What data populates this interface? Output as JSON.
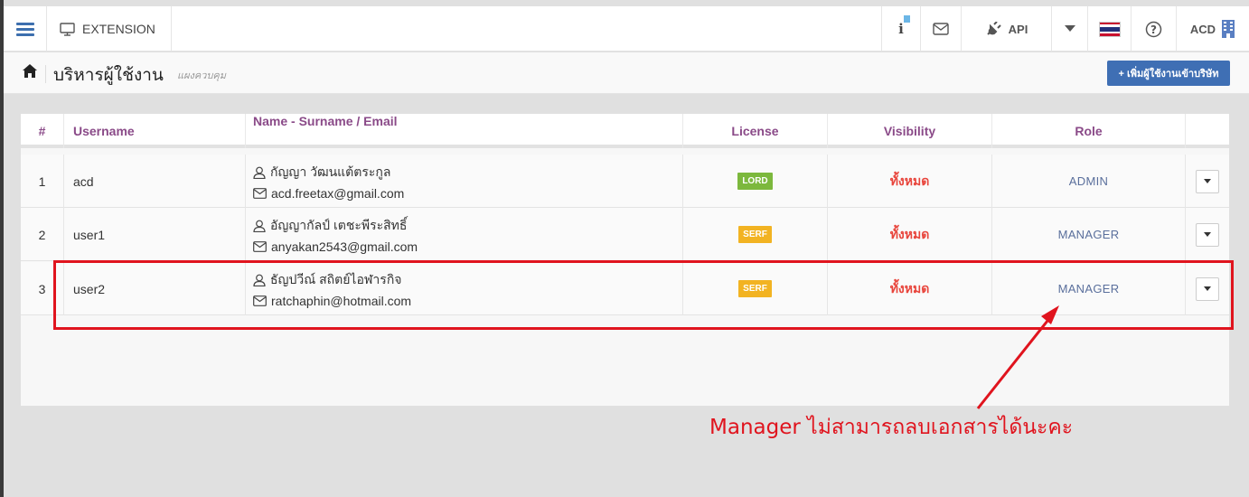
{
  "topbar": {
    "extension_label": "EXTENSION",
    "info_sup": "i",
    "api_label": "API",
    "user_label": "ACD",
    "flag_colors": [
      "#c8102e",
      "#ffffff",
      "#22317a",
      "#22317a",
      "#ffffff",
      "#c8102e"
    ]
  },
  "crumb": {
    "title": "บริหารผู้ใช้งาน",
    "subtitle": "แผงควบคุม",
    "add_button": "+ เพิ่มผู้ใช้งานเข้าบริษัท"
  },
  "table": {
    "headers": [
      "#",
      "Username",
      "Name - Surname / Email",
      "License",
      "Visibility",
      "Role",
      ""
    ],
    "rows": [
      {
        "num": "1",
        "username": "acd",
        "name": "กัญญา วัฒนแต้ตระกูล",
        "email": "acd.freetax@gmail.com",
        "license": "LORD",
        "license_color": "#7cb83d",
        "visibility": "ทั้งหมด",
        "role": "ADMIN"
      },
      {
        "num": "2",
        "username": "user1",
        "name": "อัญญากัลป์ เตชะพีระสิทธิ์",
        "email": "anyakan2543@gmail.com",
        "license": "SERF",
        "license_color": "#f2b322",
        "visibility": "ทั้งหมด",
        "role": "MANAGER"
      },
      {
        "num": "3",
        "username": "user2",
        "name": "ธัญปวีณ์ สถิตย์ไอฬารกิจ",
        "email": "ratchaphin@hotmail.com",
        "license": "SERF",
        "license_color": "#f2b322",
        "visibility": "ทั้งหมด",
        "role": "MANAGER"
      }
    ]
  },
  "annotation": {
    "note": "Manager ไม่สามารถลบเอกสารได้นะคะ",
    "color": "#e0141e"
  }
}
